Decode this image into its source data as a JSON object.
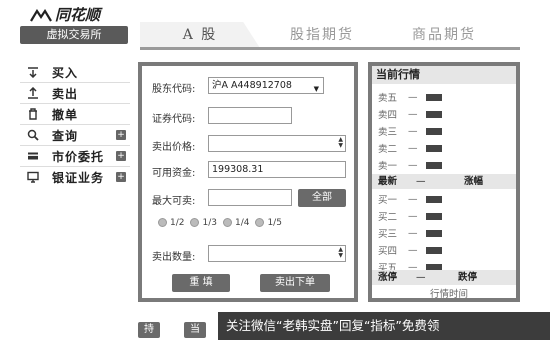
{
  "brand": {
    "name": "同花顺",
    "sim_label": "虚拟交易所"
  },
  "tabs": [
    {
      "label": "A 股",
      "active": true
    },
    {
      "label": "股指期货",
      "active": false
    },
    {
      "label": "商品期货",
      "active": false
    }
  ],
  "sidebar": {
    "items": [
      {
        "label": "买入",
        "icon": "buy-icon",
        "expandable": false
      },
      {
        "label": "卖出",
        "icon": "sell-icon",
        "expandable": false
      },
      {
        "label": "撤单",
        "icon": "trash-icon",
        "expandable": false
      },
      {
        "label": "查询",
        "icon": "search-icon",
        "expandable": true
      },
      {
        "label": "市价委托",
        "icon": "card-icon",
        "expandable": true
      },
      {
        "label": "银证业务",
        "icon": "monitor-icon",
        "expandable": true
      }
    ]
  },
  "order_form": {
    "account_label": "股东代码:",
    "account_value": "沪A A448912708",
    "code_label": "证券代码:",
    "code_value": "",
    "price_label": "卖出价格:",
    "price_value": "",
    "funds_label": "可用资金:",
    "funds_value": "199308.31",
    "max_label": "最大可卖:",
    "max_value": "",
    "all_button": "全部",
    "ratios": [
      "1/2",
      "1/3",
      "1/4",
      "1/5"
    ],
    "qty_label": "卖出数量:",
    "qty_value": "",
    "reset_button": "重 填",
    "submit_button": "卖出下单"
  },
  "quote": {
    "title": "当前行情",
    "sell_rows": [
      {
        "name": "卖五",
        "value": "—"
      },
      {
        "name": "卖四",
        "value": "—"
      },
      {
        "name": "卖三",
        "value": "—"
      },
      {
        "name": "卖二",
        "value": "—"
      },
      {
        "name": "卖一",
        "value": "—"
      }
    ],
    "mid_header": {
      "latest": "最新",
      "dash": "—",
      "change": "涨幅"
    },
    "buy_rows": [
      {
        "name": "买一",
        "value": "—"
      },
      {
        "name": "买二",
        "value": "—"
      },
      {
        "name": "买三",
        "value": "—"
      },
      {
        "name": "买四",
        "value": "—"
      },
      {
        "name": "买五",
        "value": "—"
      }
    ],
    "foot_header": {
      "limit_up": "涨停",
      "dash": "—",
      "limit_down": "跌停"
    },
    "time_label": "行情时间"
  },
  "bottom": {
    "btn1": "持仓",
    "btn2": "当日"
  },
  "watermark": "关注微信“老韩实盘”回复“指标”免费领"
}
